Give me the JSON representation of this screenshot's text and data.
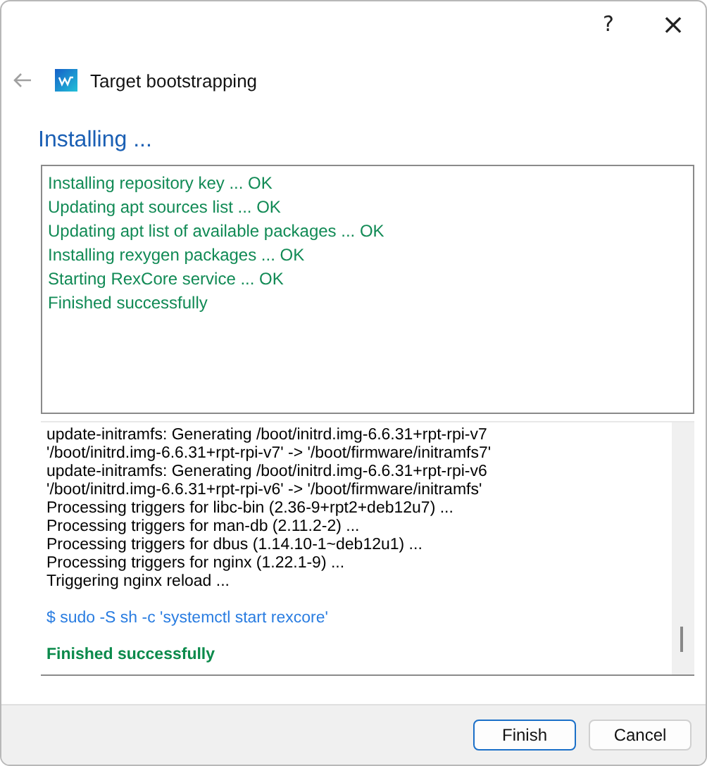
{
  "window": {
    "help": "?",
    "close": "×"
  },
  "header": {
    "title": "Target bootstrapping"
  },
  "heading": "Installing ...",
  "status_lines": [
    "Installing repository key  ...  OK",
    "Updating apt sources list  ...  OK",
    "Updating apt list of available packages  ...  OK",
    "Installing rexygen packages  ...  OK",
    "Starting RexCore service  ...  OK",
    "Finished successfully"
  ],
  "console": [
    {
      "kind": "output",
      "text": "update-initramfs: Generating /boot/initrd.img-6.6.31+rpt-rpi-v7"
    },
    {
      "kind": "output",
      "text": "'/boot/initrd.img-6.6.31+rpt-rpi-v7' -> '/boot/firmware/initramfs7'"
    },
    {
      "kind": "output",
      "text": "update-initramfs: Generating /boot/initrd.img-6.6.31+rpt-rpi-v6"
    },
    {
      "kind": "output",
      "text": "'/boot/initrd.img-6.6.31+rpt-rpi-v6' -> '/boot/firmware/initramfs'"
    },
    {
      "kind": "output",
      "text": "Processing triggers for libc-bin (2.36-9+rpt2+deb12u7) ..."
    },
    {
      "kind": "output",
      "text": "Processing triggers for man-db (2.11.2-2) ..."
    },
    {
      "kind": "output",
      "text": "Processing triggers for dbus (1.14.10-1~deb12u1) ..."
    },
    {
      "kind": "output",
      "text": "Processing triggers for nginx (1.22.1-9) ..."
    },
    {
      "kind": "output",
      "text": "Triggering nginx reload ..."
    },
    {
      "kind": "command",
      "text": "$ sudo -S sh -c 'systemctl start rexcore'"
    },
    {
      "kind": "success",
      "text": "Finished successfully"
    }
  ],
  "buttons": [
    {
      "label": "Finish",
      "default": true
    },
    {
      "label": "Cancel",
      "default": false
    }
  ]
}
